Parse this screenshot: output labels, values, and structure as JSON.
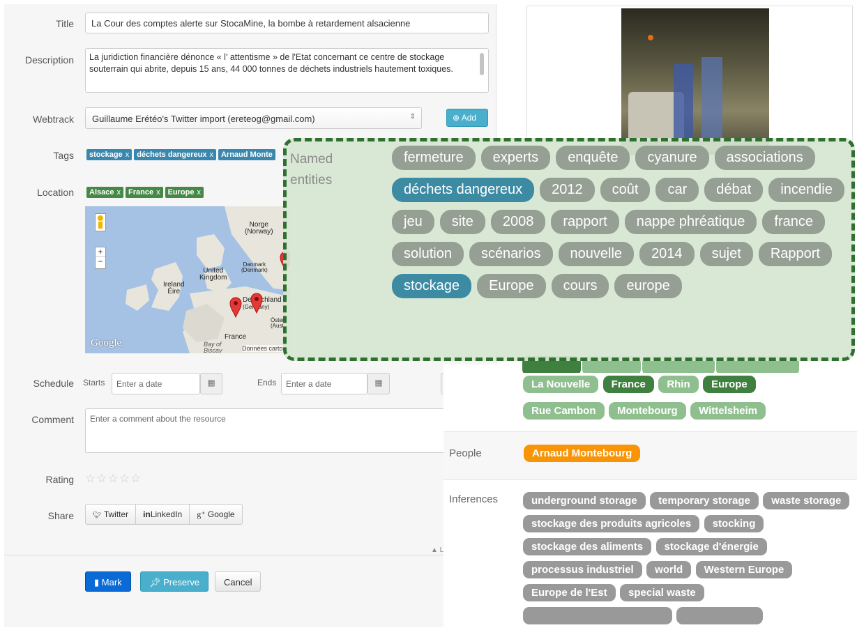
{
  "form": {
    "title_label": "Title",
    "title_value": "La Cour des comptes alerte sur StocaMine, la bombe à retardement alsacienne",
    "description_label": "Description",
    "description_value": "La juridiction financière dénonce « l' attentisme » de l'Etat concernant ce centre de stockage souterrain qui abrite, depuis 15 ans, 44 000 tonnes de déchets industriels hautement toxiques.",
    "webtrack_label": "Webtrack",
    "webtrack_value": "Guillaume Erétéo's Twitter import (ereteog@gmail.com)",
    "add_label": "Add",
    "tags_label": "Tags",
    "tags": [
      "stockage",
      "déchets dangereux",
      "Arnaud Monte"
    ],
    "location_label": "Location",
    "locations": [
      "Alsace",
      "France",
      "Europe"
    ],
    "schedule_label": "Schedule",
    "starts_label": "Starts",
    "starts_placeholder": "Enter a date",
    "ends_label": "Ends",
    "ends_placeholder": "Enter a date",
    "comment_label": "Comment",
    "comment_placeholder": "Enter a comment about the resource",
    "rating_label": "Rating",
    "rating_value": 0,
    "rating_max": 5,
    "share_label": "Share",
    "share_twitter": "Twitter",
    "share_linkedin": "LinkedIn",
    "share_google": "Google",
    "more_link": "▲ L",
    "mark_label": "Mark",
    "preserve_label": "Preserve",
    "cancel_label": "Cancel"
  },
  "map": {
    "google": "Google",
    "labels": [
      "Norge",
      "(Norway)",
      "Danmark",
      "(Denmark)",
      "United",
      "Kingdom",
      "Ireland",
      "Éire",
      "Deutschland",
      "(Germany)",
      "Öster",
      "(Aust",
      "France",
      "Bay of",
      "Biscay",
      "Données carto"
    ]
  },
  "right": {
    "places_row": [
      "La Nouvelle",
      "France",
      "Rhin",
      "Europe"
    ],
    "places_row2": [
      "Rue Cambon",
      "Montebourg",
      "Wittelsheim"
    ],
    "people_label": "People",
    "people": [
      "Arnaud Montebourg"
    ],
    "inferences_label": "Inferences",
    "inferences": [
      "underground storage",
      "temporary storage",
      "waste storage",
      "stockage des produits agricoles",
      "stocking",
      "stockage des aliments",
      "stockage d'énergie",
      "processus industriel",
      "world",
      "Western Europe",
      "Europe de l'Est",
      "special waste"
    ]
  },
  "overlay": {
    "label": "Named entities",
    "entities": [
      {
        "text": "fermeture",
        "hl": false
      },
      {
        "text": "experts",
        "hl": false
      },
      {
        "text": "enquête",
        "hl": false
      },
      {
        "text": "cyanure",
        "hl": false
      },
      {
        "text": "associations",
        "hl": false
      },
      {
        "text": "déchets dangereux",
        "hl": true
      },
      {
        "text": "2012",
        "hl": false
      },
      {
        "text": "coût",
        "hl": false
      },
      {
        "text": "car",
        "hl": false
      },
      {
        "text": "débat",
        "hl": false
      },
      {
        "text": "incendie",
        "hl": false
      },
      {
        "text": "jeu",
        "hl": false
      },
      {
        "text": "site",
        "hl": false
      },
      {
        "text": "2008",
        "hl": false
      },
      {
        "text": "rapport",
        "hl": false
      },
      {
        "text": "nappe phréatique",
        "hl": false
      },
      {
        "text": "france",
        "hl": false
      },
      {
        "text": "solution",
        "hl": false
      },
      {
        "text": "scénarios",
        "hl": false
      },
      {
        "text": "nouvelle",
        "hl": false
      },
      {
        "text": "2014",
        "hl": false
      },
      {
        "text": "sujet",
        "hl": false
      },
      {
        "text": "Rapport",
        "hl": false
      },
      {
        "text": "stockage",
        "hl": true
      },
      {
        "text": "Europe",
        "hl": false
      },
      {
        "text": "cours",
        "hl": false
      },
      {
        "text": "europe",
        "hl": false
      }
    ]
  },
  "colors": {
    "blue_tag": "#3a87ad",
    "green_tag": "#468847",
    "overlay_border": "#2f6f2f",
    "orange": "#f89406"
  }
}
